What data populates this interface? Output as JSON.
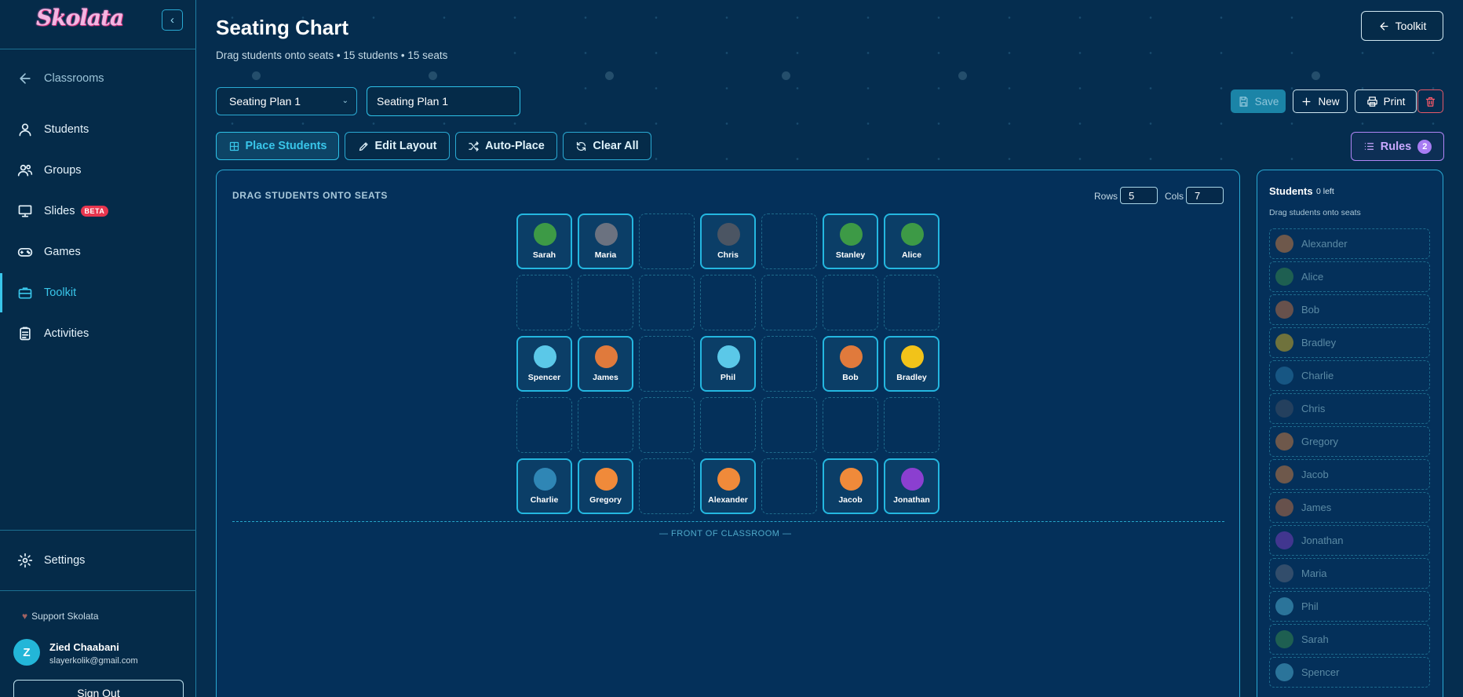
{
  "app": {
    "logo": "Skolata"
  },
  "sidebar": {
    "back": "Classrooms",
    "items": [
      {
        "label": "Students",
        "icon": "user-icon"
      },
      {
        "label": "Groups",
        "icon": "users-icon"
      },
      {
        "label": "Slides",
        "icon": "presentation-icon",
        "badge": "BETA"
      },
      {
        "label": "Games",
        "icon": "gamepad-icon"
      },
      {
        "label": "Toolkit",
        "icon": "toolbox-icon",
        "active": true
      },
      {
        "label": "Activities",
        "icon": "clipboard-icon"
      }
    ],
    "settings": "Settings",
    "support": "Support Skolata",
    "user": {
      "initial": "Z",
      "name": "Zied Chaabani",
      "email": "slayerkolik@gmail.com"
    },
    "signout": "Sign Out"
  },
  "header": {
    "title": "Seating Chart",
    "subtitle": "Drag students onto seats • 15 students • 15 seats",
    "toolkit_button": "Toolkit"
  },
  "plan": {
    "selected": "Seating Plan 1",
    "name_value": "Seating Plan 1",
    "save": "Save",
    "new": "New",
    "print": "Print"
  },
  "modes": {
    "place": "Place Students",
    "edit": "Edit Layout",
    "auto": "Auto-Place",
    "clear": "Clear All",
    "rules": "Rules",
    "rules_count": "2"
  },
  "grid": {
    "label": "DRAG STUDENTS ONTO SEATS",
    "rows_label": "Rows",
    "rows": "5",
    "cols_label": "Cols",
    "cols": "7",
    "front_label": "— FRONT OF CLASSROOM —",
    "seats": [
      [
        "Sarah",
        "Maria",
        "",
        "Chris",
        "",
        "Stanley",
        "Alice"
      ],
      [
        "",
        "",
        "",
        "",
        "",
        "",
        ""
      ],
      [
        "Spencer",
        "James",
        "",
        "Phil",
        "",
        "Bob",
        "Bradley"
      ],
      [
        "",
        "",
        "",
        "",
        "",
        "",
        ""
      ],
      [
        "Charlie",
        "Gregory",
        "",
        "Alexander",
        "",
        "Jacob",
        "Jonathan"
      ]
    ]
  },
  "roster": {
    "title": "Students",
    "left": "0 left",
    "hint": "Drag students onto seats",
    "students": [
      "Alexander",
      "Alice",
      "Bob",
      "Bradley",
      "Charlie",
      "Chris",
      "Gregory",
      "Jacob",
      "James",
      "Jonathan",
      "Maria",
      "Phil",
      "Sarah",
      "Spencer"
    ]
  },
  "avatar_colors": {
    "Sarah": "#3d9a46",
    "Maria": "#6b7280",
    "Chris": "#4b5563",
    "Stanley": "#3d9a46",
    "Alice": "#3d9a46",
    "Spencer": "#5bc8e8",
    "James": "#e07a3c",
    "Phil": "#5bc8e8",
    "Bob": "#e07a3c",
    "Bradley": "#f2c319",
    "Charlie": "#2f86b5",
    "Gregory": "#f08a3a",
    "Alexander": "#f08a3a",
    "Jacob": "#f08a3a",
    "Jonathan": "#8b3fd0"
  }
}
